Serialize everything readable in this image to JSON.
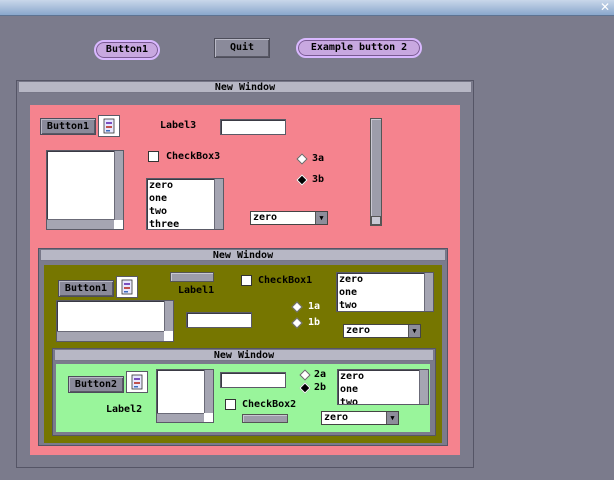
{
  "window": {
    "close_glyph": "✕"
  },
  "top": {
    "button1": "Button1",
    "quit": "Quit",
    "example": "Example button 2"
  },
  "win1": {
    "title": "New Window",
    "button": "Button1",
    "label": "Label3",
    "checkbox": "CheckBox3",
    "radio": [
      "3a",
      "3b"
    ],
    "list": [
      "zero",
      "one",
      "two",
      "three"
    ],
    "combo": "zero",
    "bg": "#f5838e"
  },
  "win2": {
    "title": "New Window",
    "button": "Button1",
    "label": "Label1",
    "checkbox": "CheckBox1",
    "radio": [
      "1a",
      "1b"
    ],
    "list": [
      "zero",
      "one",
      "two"
    ],
    "combo": "zero",
    "bg": "#767600"
  },
  "win3": {
    "title": "New Window",
    "button": "Button2",
    "label": "Label2",
    "checkbox": "CheckBox2",
    "radio": [
      "2a",
      "2b"
    ],
    "list": [
      "zero",
      "one",
      "two"
    ],
    "combo": "zero",
    "bg": "#99f59b"
  }
}
